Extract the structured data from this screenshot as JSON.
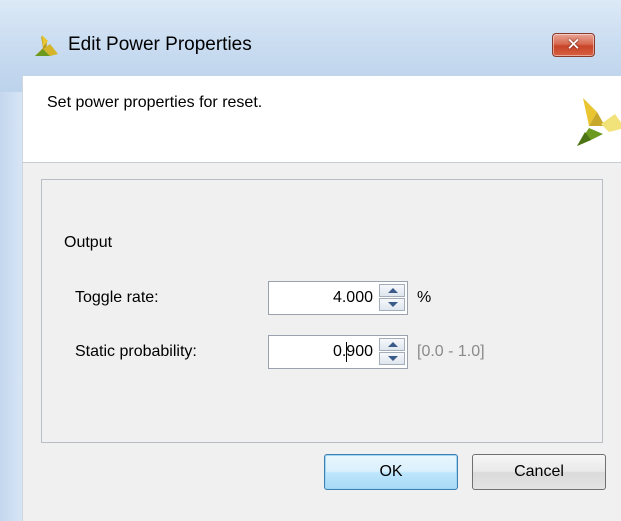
{
  "window": {
    "title": "Edit Power Properties",
    "close_label": "✕"
  },
  "header": {
    "subtitle": "Set power properties for reset."
  },
  "form": {
    "section_label": "Output",
    "toggle_rate": {
      "label": "Toggle rate:",
      "value": "4.000",
      "unit": "%"
    },
    "static_probability": {
      "label": "Static probability:",
      "value": "0.900",
      "range_hint": "[0.0 - 1.0]"
    }
  },
  "buttons": {
    "ok_label": "OK",
    "cancel_label": "Cancel"
  },
  "icons": {
    "app_logo": "xilinx-logo-icon",
    "brand": "xilinx-brand-icon",
    "close": "close-icon",
    "spin_up": "spin-up-icon",
    "spin_down": "spin-down-icon"
  },
  "colors": {
    "titlebar": "#c9dcf0",
    "close_button": "#c8452a",
    "primary_button": "#bee6fd",
    "logo_green": "#6b9a1f",
    "logo_yellow": "#f2cc2b"
  }
}
